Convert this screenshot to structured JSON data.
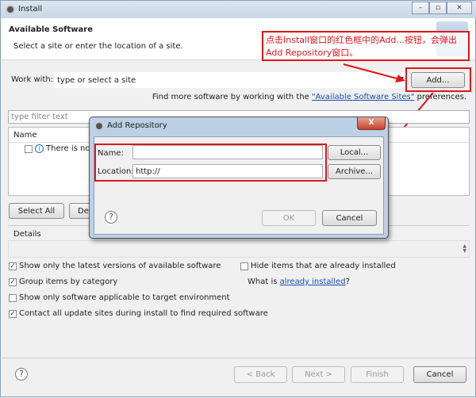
{
  "window": {
    "title": "Install",
    "controls": [
      "minimize",
      "maximize",
      "close"
    ]
  },
  "header": {
    "title": "Available Software",
    "subtitle": "Select a site or enter the location of a site."
  },
  "annotation": {
    "text_line1": "点击Install窗口的红色框中的Add...按钮，会弹出",
    "text_line2": "Add Repository窗口。",
    "color": "#e0151b"
  },
  "work_with": {
    "label": "Work with:",
    "placeholder": "type or select a site",
    "add_button": "Add..."
  },
  "find_more": {
    "prefix": "Find more software by working with the ",
    "link": "\"Available Software Sites\"",
    "suffix": " preferences."
  },
  "filter": {
    "placeholder": "type filter text"
  },
  "table": {
    "columns": [
      "Name"
    ],
    "rows": [
      {
        "text": "There is no"
      }
    ]
  },
  "buttons": {
    "select_all": "Select All",
    "deselect_all": "Des"
  },
  "details": {
    "label": "Details"
  },
  "options": {
    "latest": {
      "label": "Show only the latest versions of available software",
      "checked": true
    },
    "group": {
      "label": "Group items by category",
      "checked": true
    },
    "applicable": {
      "label": "Show only software applicable to target environment",
      "checked": false
    },
    "contact": {
      "label": "Contact all update sites during install to find required software",
      "checked": true
    },
    "hide": {
      "label": "Hide items that are already installed",
      "checked": false
    },
    "what_is_prefix": "What is ",
    "what_is_link": "already installed",
    "what_is_suffix": "?"
  },
  "footer": {
    "back": "< Back",
    "next": "Next >",
    "finish": "Finish",
    "cancel": "Cancel"
  },
  "dialog": {
    "title": "Add Repository",
    "name_label": "Name:",
    "name_value": "",
    "location_label": "Location:",
    "location_value": "http://",
    "local": "Local...",
    "archive": "Archive...",
    "ok": "OK",
    "cancel": "Cancel",
    "close": "X"
  }
}
